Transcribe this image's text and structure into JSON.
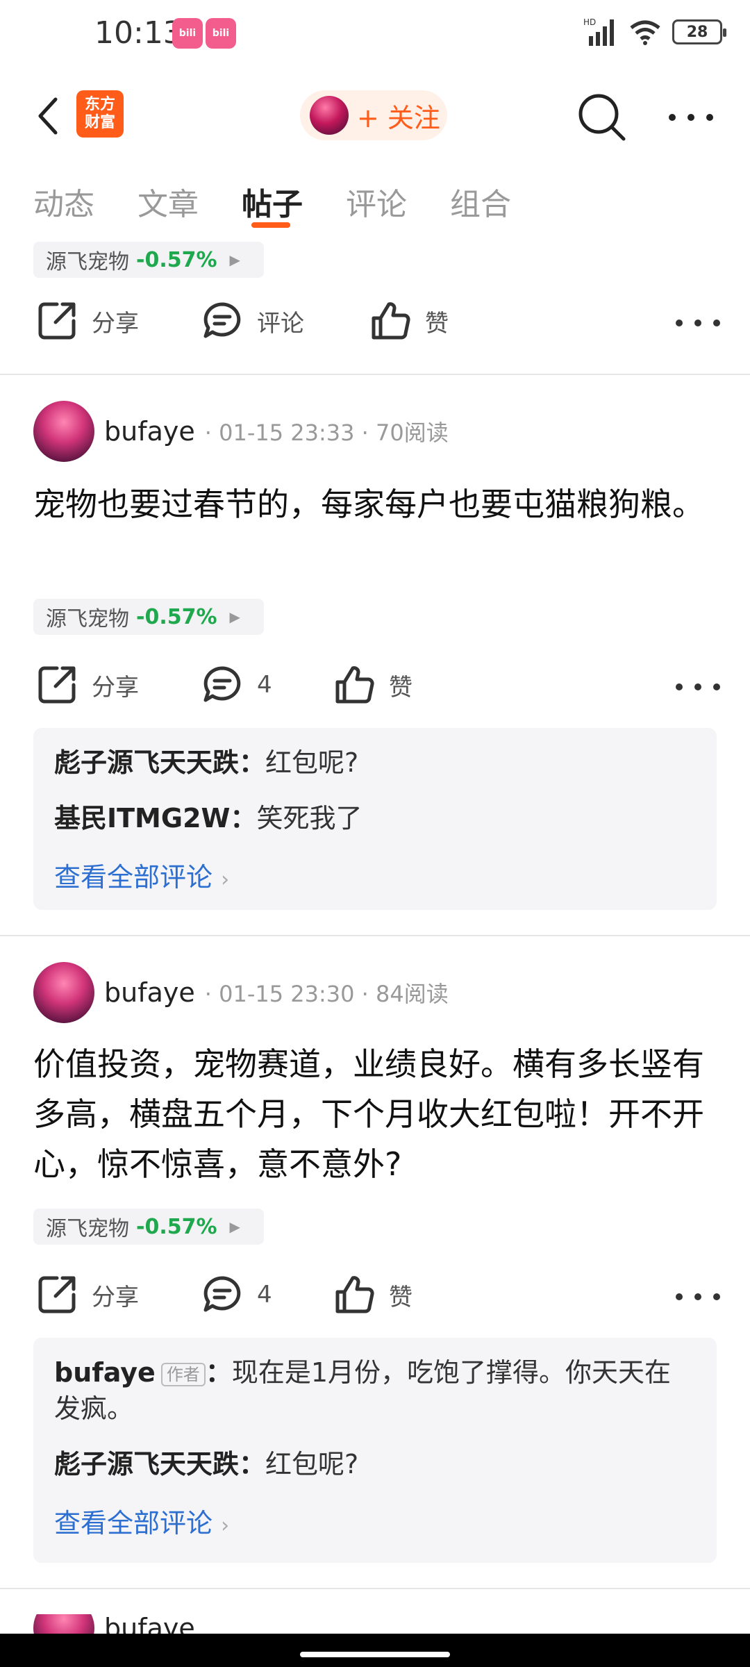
{
  "status": {
    "time": "10:13",
    "bili_label": "bili",
    "network": "HD",
    "battery": "28"
  },
  "nav": {
    "brand_line1": "东方",
    "brand_line2": "财富",
    "follow_label": "+ 关注"
  },
  "tabs": [
    {
      "label": "动态"
    },
    {
      "label": "文章"
    },
    {
      "label": "帖子"
    },
    {
      "label": "评论"
    },
    {
      "label": "组合"
    }
  ],
  "actions": {
    "share": "分享",
    "comment": "评论",
    "like": "赞"
  },
  "top_stock": {
    "name": "源飞宠物",
    "pct": "-0.57%"
  },
  "posts": [
    {
      "author": "bufaye",
      "meta": "· 01-15 23:33 · 70阅读",
      "body": "宠物也要过春节的，每家每户也要屯猫粮狗粮。",
      "stock": {
        "name": "源飞宠物",
        "pct": "-0.57%"
      },
      "comment_count": "4",
      "comments": [
        {
          "user": "彪子源飞天天跌",
          "sep": "：",
          "text": "红包呢?"
        },
        {
          "user": "基民ITMG2W",
          "sep": "：",
          "text": "笑死我了"
        }
      ],
      "view_all": "查看全部评论"
    },
    {
      "author": "bufaye",
      "meta": "· 01-15 23:30 · 84阅读",
      "body": "价值投资，宠物赛道，业绩良好。横有多长竖有多高，横盘五个月，下个月收大红包啦！开不开心，惊不惊喜，意不意外?",
      "stock": {
        "name": "源飞宠物",
        "pct": "-0.57%"
      },
      "comment_count": "4",
      "comments": [
        {
          "user": "bufaye",
          "tag": "作者",
          "sep": "：",
          "text": "现在是1月份，吃饱了撑得。你天天在发疯。"
        },
        {
          "user": "彪子源飞天天跌",
          "sep": "：",
          "text": "红包呢?"
        }
      ],
      "view_all": "查看全部评论"
    }
  ],
  "bottom_partial": {
    "author": "bufaye"
  }
}
